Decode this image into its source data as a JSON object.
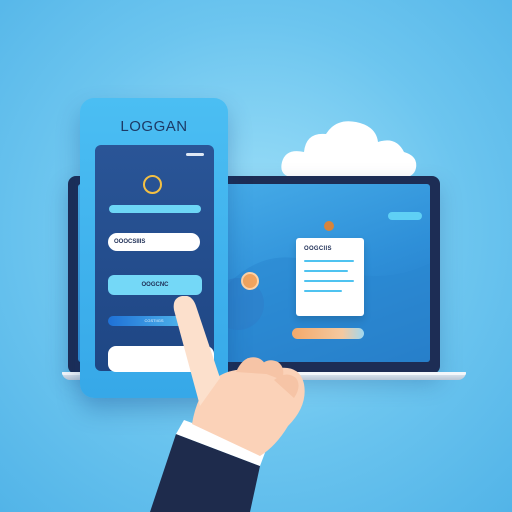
{
  "phone": {
    "title": "LOGGAN",
    "field_text": "OOOCSIIIS",
    "button_label": "OOGCNC",
    "small_button_label": "CGSTIIGS"
  },
  "laptop": {
    "card_title": "OOGCIIS"
  },
  "colors": {
    "background": "#6cc5ef",
    "phone": "#36a8e8",
    "phone_screen": "#1e4684",
    "accent_cyan": "#6dd6f6",
    "accent_orange": "#f3a96a",
    "laptop_frame": "#1d2d55"
  },
  "icons": [
    "cloud-icon",
    "ring-icon",
    "pin-icon",
    "pointing-hand-icon"
  ]
}
